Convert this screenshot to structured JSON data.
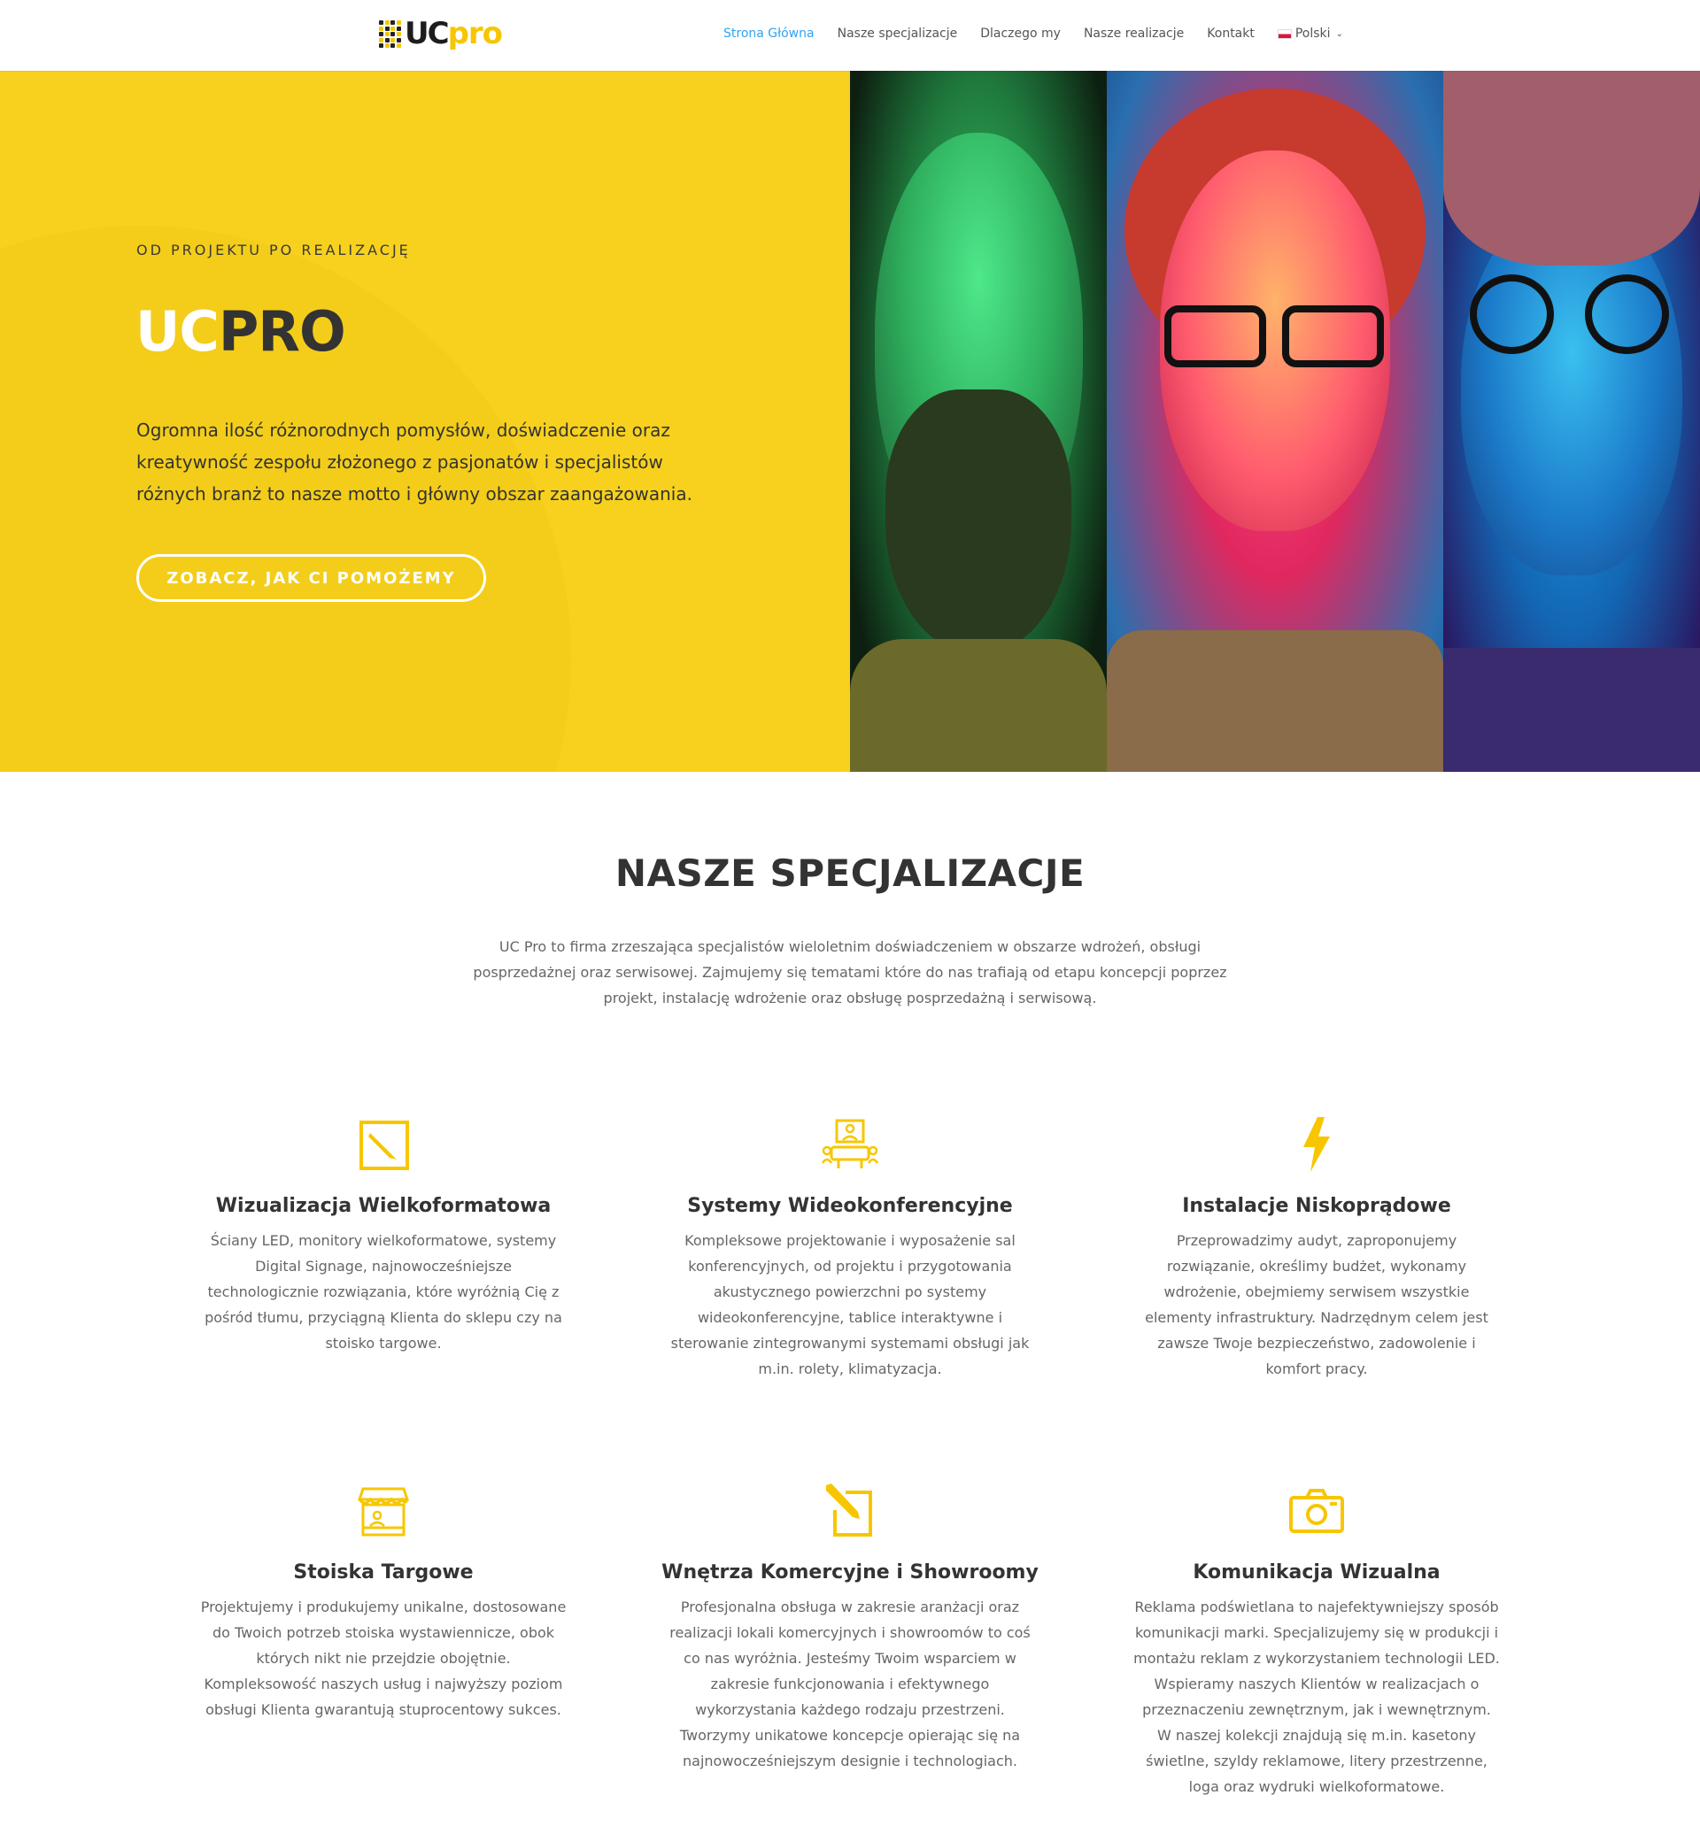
{
  "header": {
    "logo": {
      "uc": "UC",
      "pro": "pro"
    },
    "nav": [
      {
        "label": "Strona Główna",
        "active": true
      },
      {
        "label": "Nasze specjalizacje",
        "active": false
      },
      {
        "label": "Dlaczego my",
        "active": false
      },
      {
        "label": "Nasze realizacje",
        "active": false
      },
      {
        "label": "Kontakt",
        "active": false
      }
    ],
    "language": {
      "label": "Polski",
      "icon": "chevron-down-icon"
    }
  },
  "hero": {
    "eyebrow": "OD PROJEKTU PO REALIZACJĘ",
    "title_light": "UC",
    "title_dark": "PRO",
    "description": "Ogromna ilość różnorodnych pomysłów, doświadczenie oraz kreatywność zespołu złożonego z pasjonatów i specjalistów różnych branż to nasze motto i główny obszar zaangażowania.",
    "button": "ZOBACZ, JAK CI POMOŻEMY"
  },
  "specializations": {
    "title": "NASZE SPECJALIZACJE",
    "intro": "UC Pro to firma zrzeszająca specjalistów wieloletnim doświadczeniem w obszarze wdrożeń, obsługi posprzedażnej oraz serwisowej. Zajmujemy się tematami które do nas trafiają od etapu koncepcji poprzez projekt, instalację wdrożenie oraz obsługę posprzedażną i serwisową.",
    "items": [
      {
        "icon": "pencil-square-icon",
        "title": "Wizualizacja Wielkoformatowa",
        "text": "Ściany LED, monitory wielkoformatowe, systemy Digital Signage, najnowocześniejsze technologicznie rozwiązania, które wyróżnią Cię z pośród tłumu, przyciągną Klienta do sklepu czy na stoisko targowe."
      },
      {
        "icon": "videoconference-icon",
        "title": "Systemy Wideokonferencyjne",
        "text": "Kompleksowe projektowanie i wyposażenie sal konferencyjnych, od projektu i przygotowania akustycznego powierzchni po systemy wideokonferencyjne, tablice interaktywne i sterowanie zintegrowanymi systemami obsługi jak m.in. rolety, klimatyzacja."
      },
      {
        "icon": "lightning-icon",
        "title": "Instalacje Niskoprądowe",
        "text": "Przeprowadzimy audyt, zaproponujemy rozwiązanie, określimy budżet, wykonamy wdrożenie, obejmiemy serwisem wszystkie elementy infrastruktury. Nadrzędnym celem jest zawsze Twoje bezpieczeństwo, zadowolenie i komfort pracy."
      },
      {
        "icon": "store-stand-icon",
        "title": "Stoiska Targowe",
        "text": "Projektujemy i produkujemy unikalne, dostosowane do Twoich potrzeb stoiska wystawiennicze, obok których nikt nie przejdzie obojętnie. Kompleksowość naszych usług i najwyższy poziom obsługi Klienta gwarantują stuprocentowy sukces."
      },
      {
        "icon": "pencil-design-icon",
        "title": "Wnętrza Komercyjne i Showroomy",
        "text": "Profesjonalna obsługa w zakresie aranżacji oraz realizacji lokali komercyjnych i showroomów to coś co nas wyróżnia. Jesteśmy Twoim wsparciem w zakresie funkcjonowania i efektywnego wykorzystania każdego rodzaju przestrzeni. Tworzymy unikatowe koncepcje opierając się na najnowocześniejszym designie i technologiach."
      },
      {
        "icon": "camera-icon",
        "title": "Komunikacja Wizualna",
        "text": "Reklama podświetlana to najefektywniejszy sposób komunikacji marki. Specjalizujemy się w produkcji i montażu reklam z wykorzystaniem technologii LED. Wspieramy naszych Klientów w realizacjach o przeznaczeniu zewnętrznym, jak i wewnętrznym. W naszej kolekcji znajdują się m.in. kasetony świetlne, szyldy reklamowe, litery przestrzenne, loga oraz wydruki wielkoformatowe."
      }
    ]
  },
  "colors": {
    "accent": "#f7d11e",
    "icon": "#f7c600",
    "nav_active": "#2ea3f2",
    "text_dark": "#333333"
  }
}
